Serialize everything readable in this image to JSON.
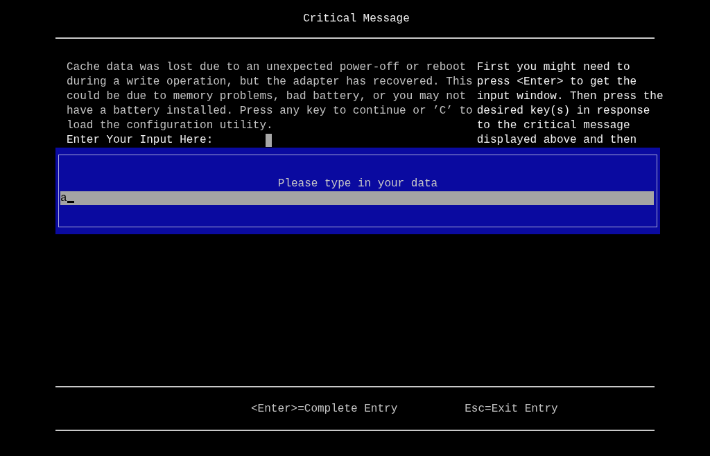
{
  "header": {
    "title": "Critical Message"
  },
  "message": {
    "text": "Cache data was lost due to an unexpected power-off or reboot during a write operation, but the adapter has recovered. This could be due to memory problems, bad battery, or you may not have a battery installed. Press any key to continue or ’C’ to load the configuration utility.",
    "input_label": "Enter Your Input Here:"
  },
  "help": {
    "text": "First you might need to press <Enter> to get the input window. Then press the desired key(s) in response to the critical message displayed above and then"
  },
  "dialog": {
    "prompt": "Please type in your data",
    "value": "a"
  },
  "footer": {
    "keys": [
      "<Enter>=Complete Entry",
      "Esc=Exit Entry"
    ]
  }
}
